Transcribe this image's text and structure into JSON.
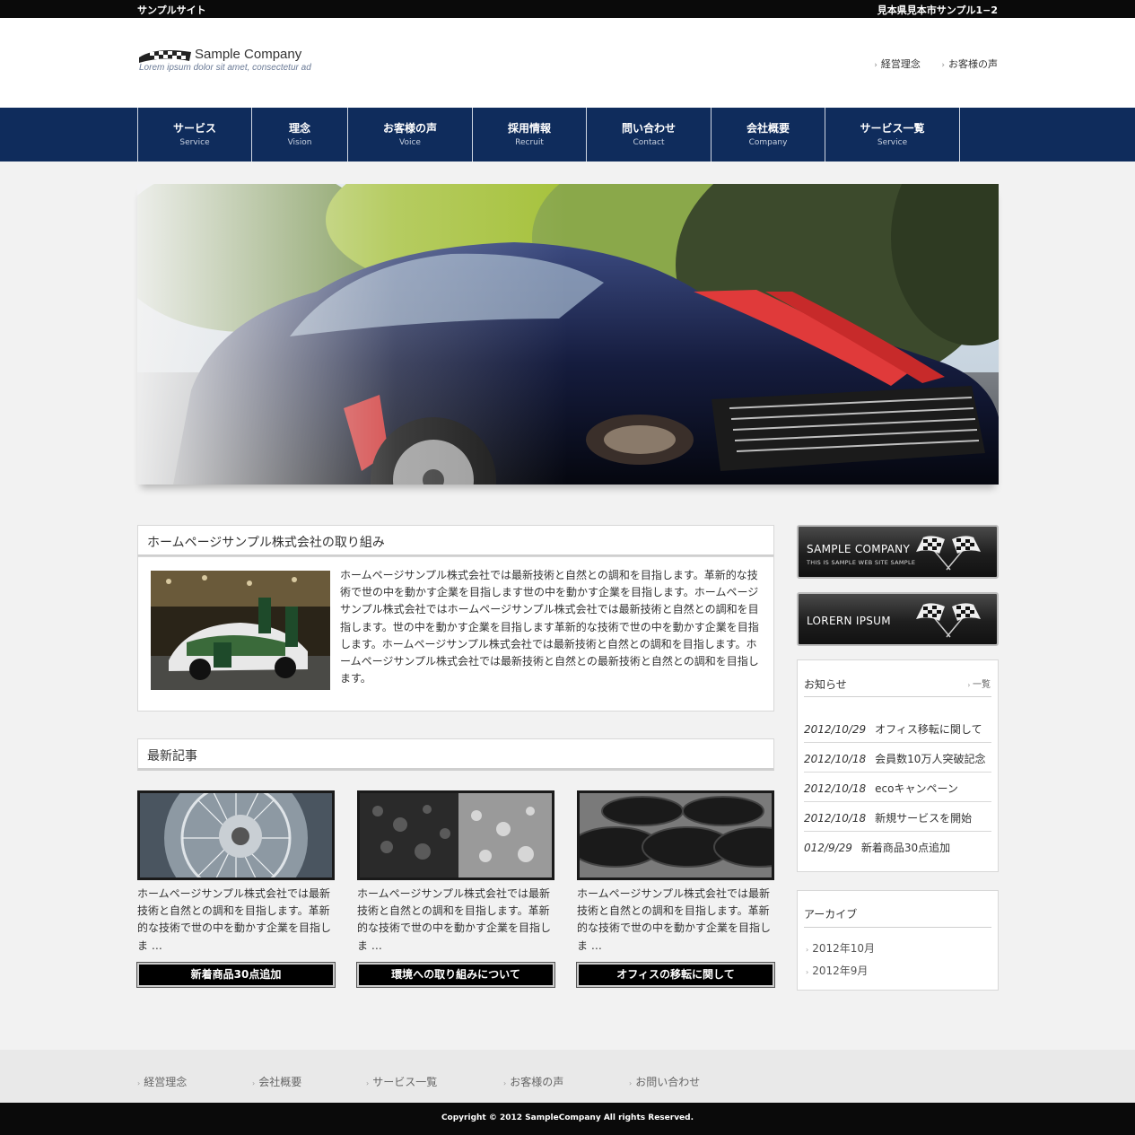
{
  "topbar": {
    "site_name": "サンプルサイト",
    "address": "見本県見本市サンプル1−2"
  },
  "logo": {
    "name": "Sample Company",
    "tagline": "Lorem ipsum dolor sit amet, consectetur ad"
  },
  "header_links": [
    "経営理念",
    "お客様の声"
  ],
  "nav": [
    {
      "jp": "サービス",
      "en": "Service"
    },
    {
      "jp": "理念",
      "en": "Vision"
    },
    {
      "jp": "お客様の声",
      "en": "Voice"
    },
    {
      "jp": "採用情報",
      "en": "Recruit"
    },
    {
      "jp": "問い合わせ",
      "en": "Contact"
    },
    {
      "jp": "会社概要",
      "en": "Company"
    },
    {
      "jp": "サービス一覧",
      "en": "Service"
    }
  ],
  "intro": {
    "title": "ホームページサンプル株式会社の取り組み",
    "text": "ホームページサンプル株式会社では最新技術と自然との調和を目指します。革新的な技術で世の中を動かす企業を目指します世の中を動かす企業を目指します。ホームページサンプル株式会社ではホームページサンプル株式会社では最新技術と自然との調和を目指します。世の中を動かす企業を目指します革新的な技術で世の中を動かす企業を目指します。ホームページサンプル株式会社では最新技術と自然との調和を目指します。ホームページサンプル株式会社では最新技術と自然との最新技術と自然との調和を目指します。"
  },
  "latest": {
    "title": "最新記事",
    "cards": [
      {
        "text": "ホームページサンプル株式会社では最新技術と自然との調和を目指します。革新的な技術で世の中を動かす企業を目指しま …",
        "button": "新着商品30点追加"
      },
      {
        "text": "ホームページサンプル株式会社では最新技術と自然との調和を目指します。革新的な技術で世の中を動かす企業を目指しま …",
        "button": "環境への取り組みについて"
      },
      {
        "text": "ホームページサンプル株式会社では最新技術と自然との調和を目指します。革新的な技術で世の中を動かす企業を目指しま …",
        "button": "オフィスの移転に関して"
      }
    ]
  },
  "banners": [
    {
      "title": "SAMPLE COMPANY",
      "sub": "THIS IS SAMPLE WEB SITE SAMPLE"
    },
    {
      "title": "LORERN IPSUM",
      "sub": ""
    }
  ],
  "news": {
    "title": "お知らせ",
    "more": "一覧",
    "items": [
      {
        "date": "2012/10/29",
        "text": "オフィス移転に関して"
      },
      {
        "date": "2012/10/18",
        "text": "会員数10万人突破記念"
      },
      {
        "date": "2012/10/18",
        "text": "ecoキャンペーン"
      },
      {
        "date": "2012/10/18",
        "text": "新規サービスを開始"
      },
      {
        "date": "012/9/29",
        "text": "新着商品30点追加"
      }
    ]
  },
  "archive": {
    "title": "アーカイブ",
    "items": [
      "2012年10月",
      "2012年9月"
    ]
  },
  "footer_links": [
    "経営理念",
    "会社概要",
    "サービス一覧",
    "お客様の声",
    "お問い合わせ"
  ],
  "copyright": "Copyright © 2012 SampleCompany All rights Reserved."
}
